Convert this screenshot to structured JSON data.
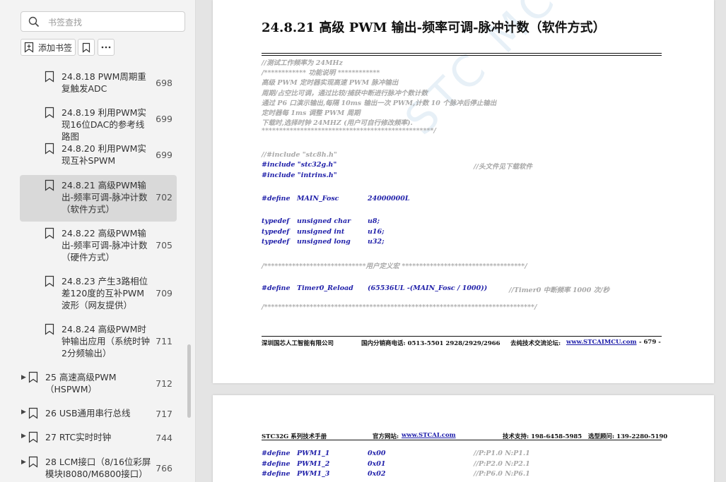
{
  "sidebar": {
    "search_placeholder": "书签查找",
    "add_bookmark_label": "添加书签",
    "items": [
      {
        "label": "24.8.18 PWM周期重复触发ADC",
        "page": "698",
        "level": 2,
        "selected": false
      },
      {
        "label": "24.8.19 利用PWM实现16位DAC的参考线路图",
        "page": "699",
        "level": 2,
        "selected": false
      },
      {
        "label": "24.8.20 利用PWM实现互补SPWM",
        "page": "699",
        "level": 2,
        "selected": false
      },
      {
        "label": "24.8.21 高级PWM输出-频率可调-脉冲计数（软件方式）",
        "page": "702",
        "level": 2,
        "selected": true
      },
      {
        "label": "24.8.22 高级PWM输出-频率可调-脉冲计数（硬件方式）",
        "page": "705",
        "level": 2,
        "selected": false
      },
      {
        "label": "24.8.23 产生3路相位差120度的互补PWM波形（网友提供）",
        "page": "709",
        "level": 2,
        "selected": false
      },
      {
        "label": "24.8.24 高级PWM时钟输出应用（系统时钟2分频输出）",
        "page": "711",
        "level": 2,
        "selected": false
      },
      {
        "label": "25 高速高级PWM（HSPWM）",
        "page": "712",
        "level": 1,
        "selected": false
      },
      {
        "label": "26 USB通用串行总线",
        "page": "717",
        "level": 1,
        "selected": false
      },
      {
        "label": "27 RTC实时时钟",
        "page": "744",
        "level": 1,
        "selected": false
      },
      {
        "label": "28 LCM接口（8/16位彩屏模块I8080/M6800接口）",
        "page": "766",
        "level": 1,
        "selected": false
      }
    ]
  },
  "document": {
    "watermark": "STC MCU",
    "section_title": "24.8.21   高级 PWM 输出-频率可调-脉冲计数（软件方式）",
    "comments": [
      "//测试工作频率为 24MHz",
      "/************  功能说明  ************",
      "高级 PWM 定时器实现高速 PWM 脉冲输出",
      "周期/占空比可调，通过比较/捕获中断进行脉冲个数计数",
      "通过 P6 口演示输出,每隔 10ms 输出一次 PWM,计数 10 个脉冲后停止输出",
      "定时器每 1ms 调整 PWM 周期",
      "下载时,选择时钟 24MHZ (用户可自行修改频率).",
      "*************************************************/"
    ],
    "include_comment": "//#include \"stc8h.h\"",
    "include1": "#include \"stc32g.h\"",
    "include1_comment": "//头文件见下载软件",
    "include2": "#include    \"intrins.h\"",
    "define_fosc": [
      "#define",
      "MAIN_Fosc",
      "24000000L"
    ],
    "typedefs": [
      [
        "typedef",
        "unsigned char",
        "u8;"
      ],
      [
        "typedef",
        "unsigned int",
        "u16;"
      ],
      [
        "typedef",
        "unsigned long",
        "u32;"
      ]
    ],
    "user_def_line": "/*****************************用户定义宏 ***********************************/",
    "define_timer": [
      "#define",
      "Timer0_Reload",
      "(65536UL -(MAIN_Fosc / 1000))",
      "//Timer0 中断频率 1000 次/秒"
    ],
    "end_line": "/*****************************************************************************/",
    "footer": {
      "company": "深圳国芯人工智能有限公司",
      "phone": "国内分销商电话: 0513-5501 2928/2929/2966",
      "forum_label": "去纯技术交流论坛:",
      "forum_url": "www.STCAIMCU.com",
      "page_no": "- 679 -"
    },
    "page2_header": {
      "manual": "STC32G 系列技术手册",
      "site_label": "官方网站:",
      "site_url": "www.STCAI.com",
      "support": "技术支持: 198-6458-5985",
      "consult": "选型顾问: 139-2280-5190"
    },
    "page2_defines": [
      [
        "#define",
        "PWM1_1",
        "0x00",
        "//P:P1.0    N:P1.1"
      ],
      [
        "#define",
        "PWM1_2",
        "0x01",
        "//P:P2.0    N:P2.1"
      ],
      [
        "#define",
        "PWM1_3",
        "0x02",
        "//P:P6.0    N:P6.1"
      ]
    ]
  }
}
